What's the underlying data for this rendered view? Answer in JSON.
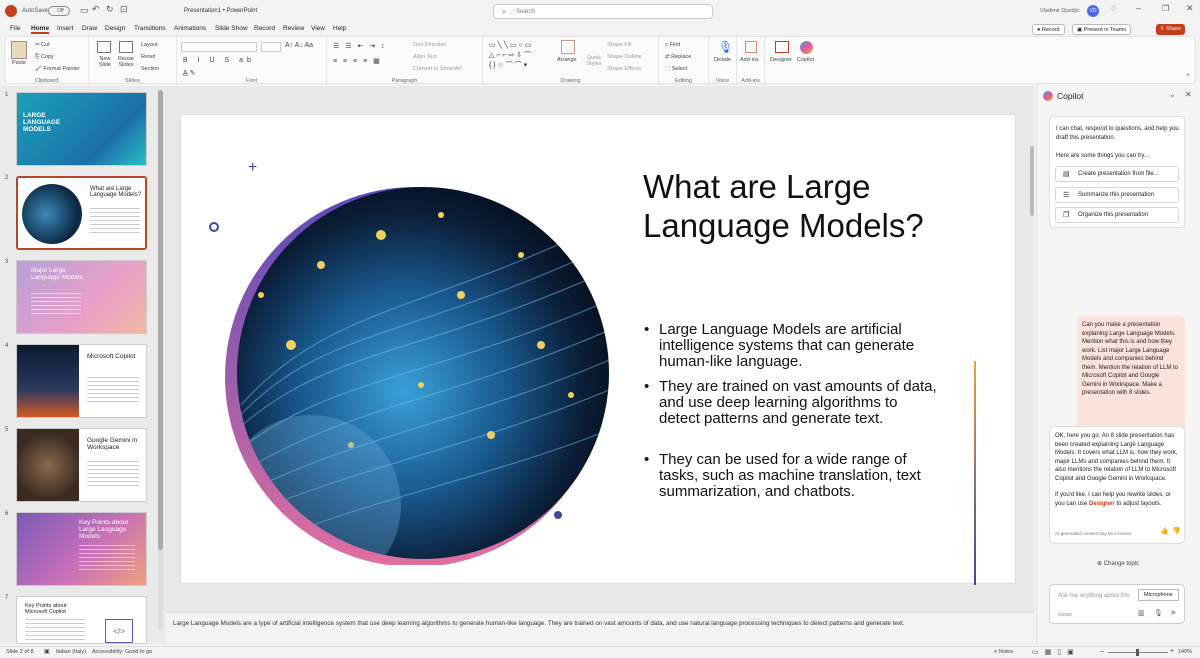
{
  "app": {
    "title": "Presentation1 • PowerPoint",
    "autosave": "AutoSave",
    "autosave_state": "Off",
    "search_placeholder": "Search",
    "user": "Vladimir Djurdjic",
    "user_initials": "VD"
  },
  "tabs": [
    "File",
    "Home",
    "Insert",
    "Draw",
    "Design",
    "Transitions",
    "Animations",
    "Slide Show",
    "Record",
    "Review",
    "View",
    "Help"
  ],
  "actions": {
    "record": "Record",
    "present_teams": "Present in Teams",
    "share": "Share"
  },
  "ribbon": {
    "clipboard": {
      "paste": "Paste",
      "cut": "Cut",
      "copy": "Copy",
      "format_painter": "Format Painter",
      "label": "Clipboard"
    },
    "slides": {
      "new_slide": "New Slide",
      "reuse_slides": "Reuse Slides",
      "layout": "Layout",
      "reset": "Reset",
      "section": "Section",
      "label": "Slides"
    },
    "font": {
      "label": "Font"
    },
    "paragraph": {
      "text_direction": "Text Direction",
      "align_text": "Align Text",
      "convert_smartart": "Convert to SmartArt",
      "label": "Paragraph"
    },
    "drawing": {
      "arrange": "Arrange",
      "quick_styles": "Quick Styles",
      "shape_fill": "Shape Fill",
      "shape_outline": "Shape Outline",
      "shape_effects": "Shape Effects",
      "label": "Drawing"
    },
    "editing": {
      "find": "Find",
      "replace": "Replace",
      "select": "Select",
      "label": "Editing"
    },
    "voice": {
      "dictate": "Dictate",
      "label": "Voice"
    },
    "addins": {
      "addins": "Add-ins",
      "label": "Add-ins"
    },
    "designer": "Designer",
    "copilot": "Copilot"
  },
  "thumbnails": [
    {
      "num": "1",
      "title": "LARGE LANGUAGE MODELS"
    },
    {
      "num": "2",
      "title": "What are Large Language Models?"
    },
    {
      "num": "3",
      "title": "Major Large Language Models"
    },
    {
      "num": "4",
      "title": "Microsoft Copilot"
    },
    {
      "num": "5",
      "title": "Google Gemini in Workspace"
    },
    {
      "num": "6",
      "title": "Key Points about Large Language Models"
    },
    {
      "num": "7",
      "title": "Key Points about Microsoft Copilot"
    }
  ],
  "slide": {
    "title": "What are Large Language Models?",
    "bullets": [
      "Large Language Models are artificial intelligence systems that can generate human-like language.",
      "They are trained on vast amounts of data, and use deep learning algorithms to detect patterns and generate text.",
      "They can be used for a wide range of tasks, such as machine translation, text summarization, and chatbots."
    ]
  },
  "notes": "Large Language Models are a type of artificial intelligence system that use deep learning algorithms to generate human-like language. They are trained on vast amounts of data, and use natural language processing techniques to detect patterns and generate text.",
  "copilot": {
    "title": "Copilot",
    "intro": "I can chat, respond to questions, and help you draft this presentation.",
    "try": "Here are some things you can try...",
    "suggestions": [
      "Create presentation from file...",
      "Summarize this presentation",
      "Organize this presentation"
    ],
    "user_msg": "Can you make a presentation explaning Large Language Models. Mention what this is and how they work. List major Large Language Models and companies behind them. Mention the relation of LLM to Microsoft Copilot and Google Gemini in Workspace. Make a presentation with 8 slides.",
    "reply": "OK, here you go. An 8 slide presentation has been created explaining Large Language Models. It covers what LLM is, how they work, major LLMs and companies behind them. It also mentions the relation of LLM to Microsoft Copilot and Google Gemini in Workspace.",
    "reply2_pre": "If you'd like, I can help you rewrite slides, or you can use ",
    "reply2_link": "Designer",
    "reply2_post": " to adjust layouts.",
    "disclaimer": "AI-generated content may be incorrect",
    "change_topic": "Change topic",
    "input_placeholder": "Ask me anything about this",
    "counter": "0/2000",
    "tooltip": "Microphone"
  },
  "status": {
    "slide": "Slide 2 of 8",
    "language": "Italian (Italy)",
    "accessibility": "Accessibility: Good to go",
    "notes": "Notes",
    "zoom": "140%"
  },
  "colors": {
    "accent": "#c43e1c",
    "share": "#c43e1c",
    "selected_thumb": "#b7472a"
  }
}
